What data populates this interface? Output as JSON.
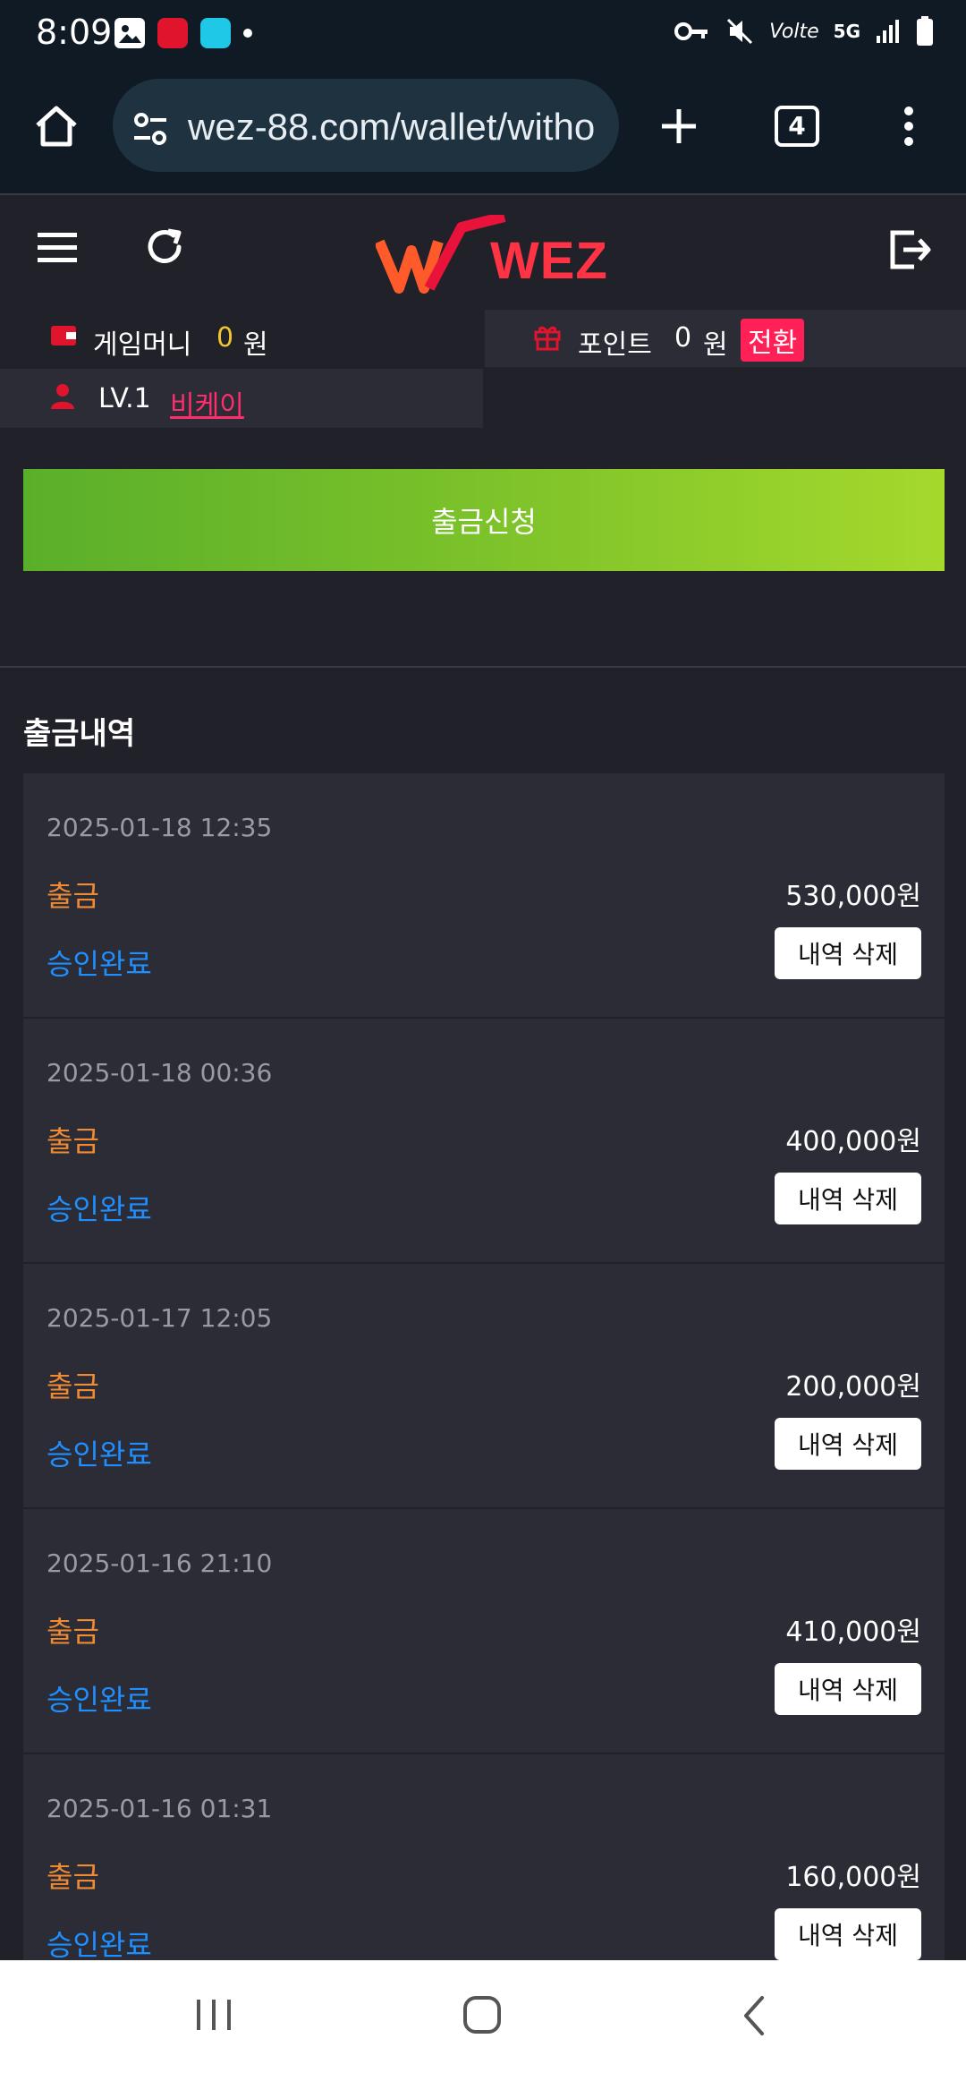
{
  "status_bar": {
    "time": "8:09",
    "network": "5G",
    "volte": "Volte"
  },
  "browser": {
    "url": "wez-88.com/wallet/witho",
    "tab_count": "4"
  },
  "header": {
    "logo_text": "WEZ"
  },
  "wallet": {
    "game_money_label": "게임머니",
    "game_money_value": "0",
    "game_money_unit": "원",
    "point_label": "포인트",
    "point_value": "0",
    "point_unit": "원",
    "convert_label": "전환",
    "level_label": "LV.1",
    "username": "비케이"
  },
  "withdraw_button": "출금신청",
  "history": {
    "title": "출금내역",
    "records": [
      {
        "date": "2025-01-18 12:35",
        "type": "출금",
        "amount": "530,000원",
        "status": "승인완료",
        "delete": "내역 삭제"
      },
      {
        "date": "2025-01-18 00:36",
        "type": "출금",
        "amount": "400,000원",
        "status": "승인완료",
        "delete": "내역 삭제"
      },
      {
        "date": "2025-01-17 12:05",
        "type": "출금",
        "amount": "200,000원",
        "status": "승인완료",
        "delete": "내역 삭제"
      },
      {
        "date": "2025-01-16 21:10",
        "type": "출금",
        "amount": "410,000원",
        "status": "승인완료",
        "delete": "내역 삭제"
      },
      {
        "date": "2025-01-16 01:31",
        "type": "출금",
        "amount": "160,000원",
        "status": "승인완료",
        "delete": "내역 삭제"
      }
    ]
  },
  "colors": {
    "type_orange": "#f08a33",
    "status_blue": "#1f8fff",
    "accent_red": "#ff2058",
    "withdraw_green": "#7cc22a"
  }
}
